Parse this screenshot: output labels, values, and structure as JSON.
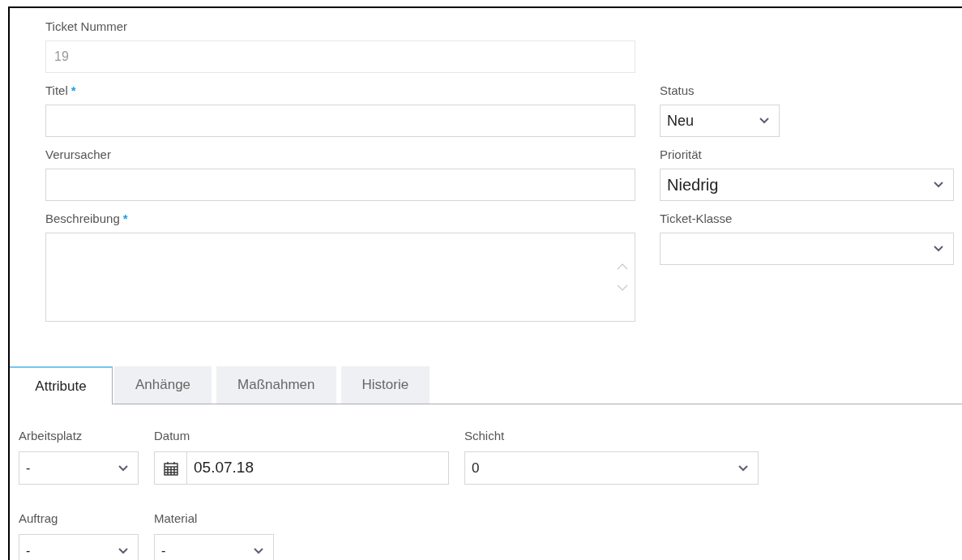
{
  "main_fields": [
    {
      "kind": "text",
      "label": "Ticket Nummer",
      "value": "19",
      "disabled": true
    },
    {
      "kind": "text",
      "label": "Titel",
      "required_mark": "*",
      "disabled": false
    },
    {
      "kind": "text",
      "label": "Verursacher",
      "disabled": false
    },
    {
      "kind": "textarea",
      "label": "Beschreibung",
      "required_mark": "*",
      "disabled": false
    }
  ],
  "side_fields": [
    {
      "kind": "select",
      "label": "Status",
      "value": "Neu"
    },
    {
      "kind": "select",
      "label": "Priorität",
      "value": "Niedrig"
    },
    {
      "kind": "select",
      "label": "Ticket-Klasse"
    }
  ],
  "tabs": [
    {
      "label": "Attribute",
      "selected": true
    },
    {
      "label": "Anhänge",
      "selected": false
    },
    {
      "label": "Maßnahmen",
      "selected": false
    },
    {
      "label": "Historie",
      "selected": false
    }
  ],
  "attribute_rows": [
    [
      {
        "kind": "select",
        "label": "Arbeitsplatz",
        "value": "-"
      },
      {
        "kind": "date",
        "label": "Datum",
        "value": "05.07.18"
      },
      {
        "kind": "select",
        "label": "Schicht",
        "value": "0"
      }
    ],
    [
      {
        "kind": "select",
        "label": "Auftrag",
        "value": "-"
      },
      {
        "kind": "select",
        "label": "Material",
        "value": "-"
      }
    ]
  ]
}
